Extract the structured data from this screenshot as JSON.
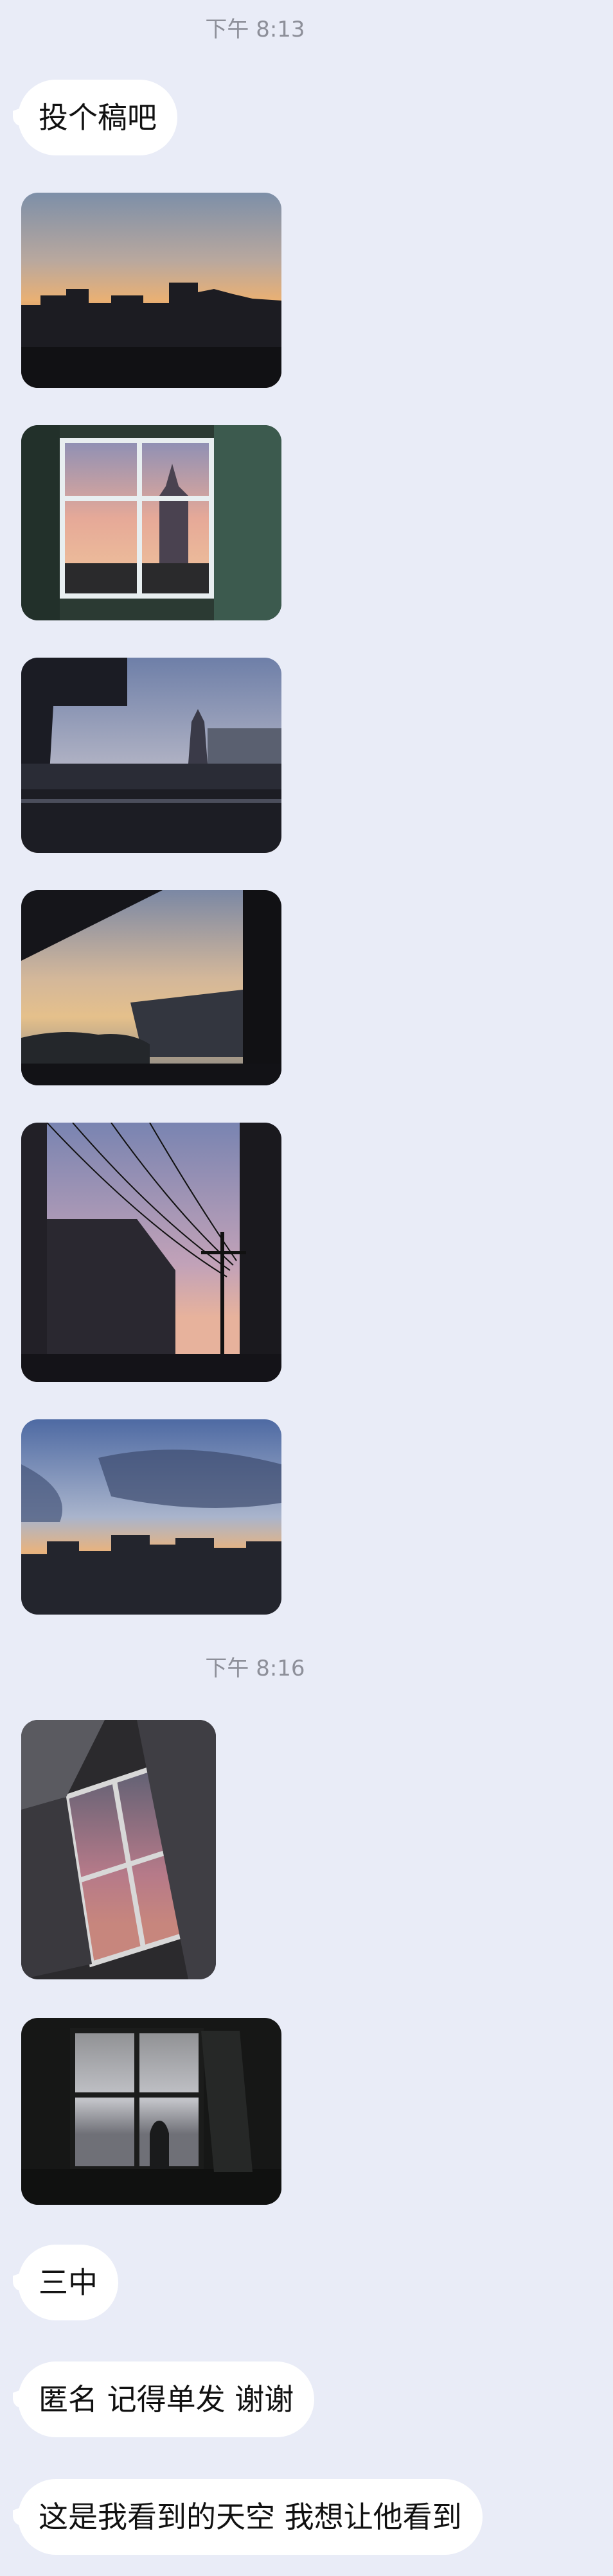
{
  "timestamps": [
    "下午 8:13",
    "下午 8:16"
  ],
  "messages": {
    "m1": "投个稿吧",
    "m2": "三中",
    "m3": "匿名 记得单发 谢谢",
    "m4": "这是我看到的天空 我想让他看到"
  },
  "photos": [
    {
      "name": "sunset-skyline-photo"
    },
    {
      "name": "window-tower-photo"
    },
    {
      "name": "balcony-tower-photo"
    },
    {
      "name": "roof-eave-clouds-photo"
    },
    {
      "name": "power-lines-photo"
    },
    {
      "name": "clouds-city-photo"
    },
    {
      "name": "curtain-window-photo"
    },
    {
      "name": "dark-window-silhouette-photo"
    }
  ],
  "colors": {
    "background": "#e9ecf7",
    "bubble": "#ffffff",
    "timestamp_text": "#8d8f99"
  }
}
